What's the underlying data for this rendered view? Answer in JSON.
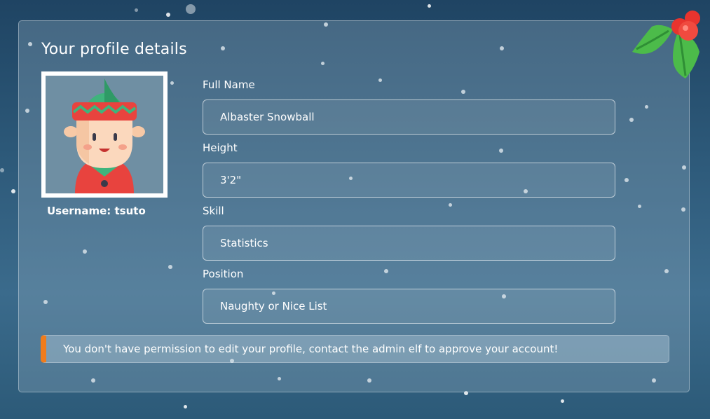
{
  "profile": {
    "title": "Your profile details",
    "username_label": "Username: tsuto",
    "avatar_icon": "elf-avatar-icon"
  },
  "fields": [
    {
      "label": "Full Name",
      "value": "Albaster Snowball"
    },
    {
      "label": "Height",
      "value": "3'2\""
    },
    {
      "label": "Skill",
      "value": "Statistics"
    },
    {
      "label": "Position",
      "value": "Naughty or Nice List"
    }
  ],
  "alert": {
    "message": "You don't have permission to edit your profile, contact the admin elf to approve your account!",
    "accent_color": "#f07c1c"
  },
  "decoration": {
    "icon": "holly-icon"
  }
}
